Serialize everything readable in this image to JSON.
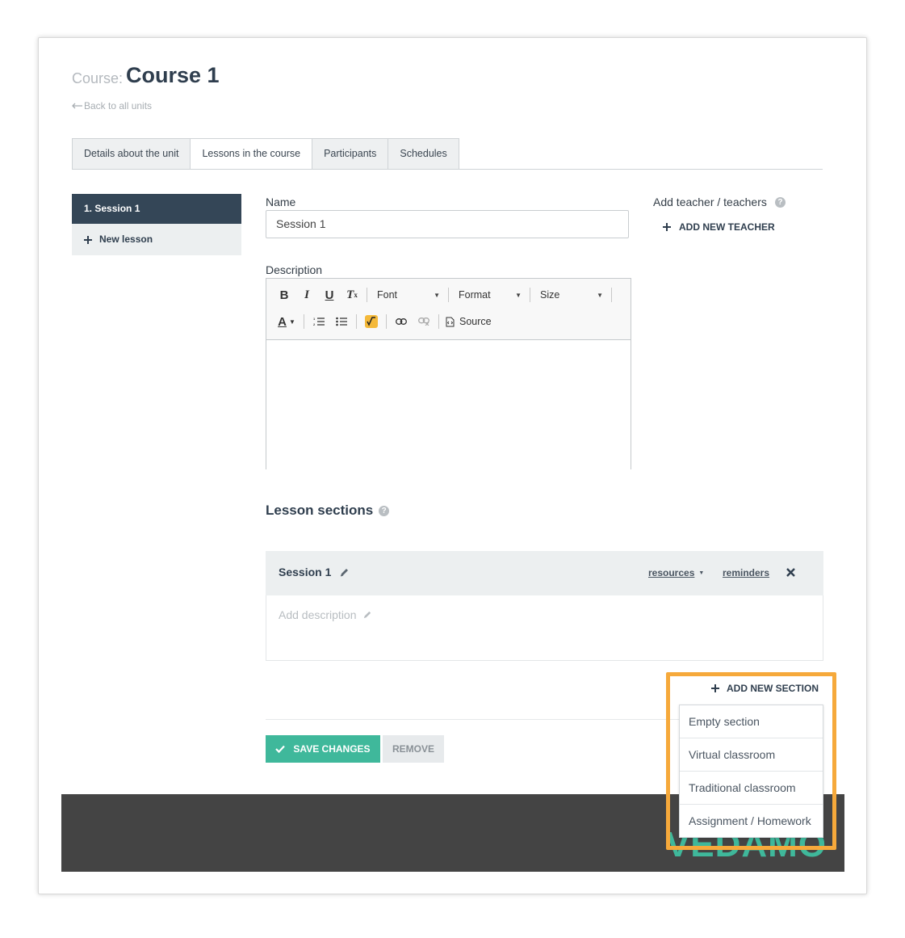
{
  "header": {
    "course_prefix": "Course:",
    "course_title": "Course 1",
    "back_link": "Back to all units"
  },
  "tabs": [
    {
      "label": "Details about the unit",
      "active": false
    },
    {
      "label": "Lessons in the course",
      "active": true
    },
    {
      "label": "Participants",
      "active": false
    },
    {
      "label": "Schedules",
      "active": false
    }
  ],
  "sidebar": {
    "active_item": "1. Session 1",
    "new_lesson": "New lesson"
  },
  "form": {
    "name_label": "Name",
    "name_value": "Session 1",
    "description_label": "Description",
    "teacher_label": "Add teacher / teachers",
    "add_teacher": "ADD NEW TEACHER"
  },
  "editor": {
    "font_combo": "Font",
    "format_combo": "Format",
    "size_combo": "Size",
    "source_label": "Source"
  },
  "sections": {
    "title": "Lesson sections",
    "items": [
      {
        "name": "Session 1",
        "resources": "resources",
        "reminders": "reminders",
        "description_placeholder": "Add description"
      }
    ],
    "add_new_section": "ADD NEW SECTION",
    "dropdown_options": [
      "Empty section",
      "Virtual classroom",
      "Traditional classroom",
      "Assignment / Homework"
    ]
  },
  "actions": {
    "save": "SAVE CHANGES",
    "remove": "REMOVE"
  },
  "footer": {
    "logo": "VEDAMO"
  },
  "colors": {
    "primary_dark": "#344657",
    "accent_green": "#3fb89b",
    "highlight_orange": "#f6a93b",
    "footer_bg": "#444444"
  }
}
